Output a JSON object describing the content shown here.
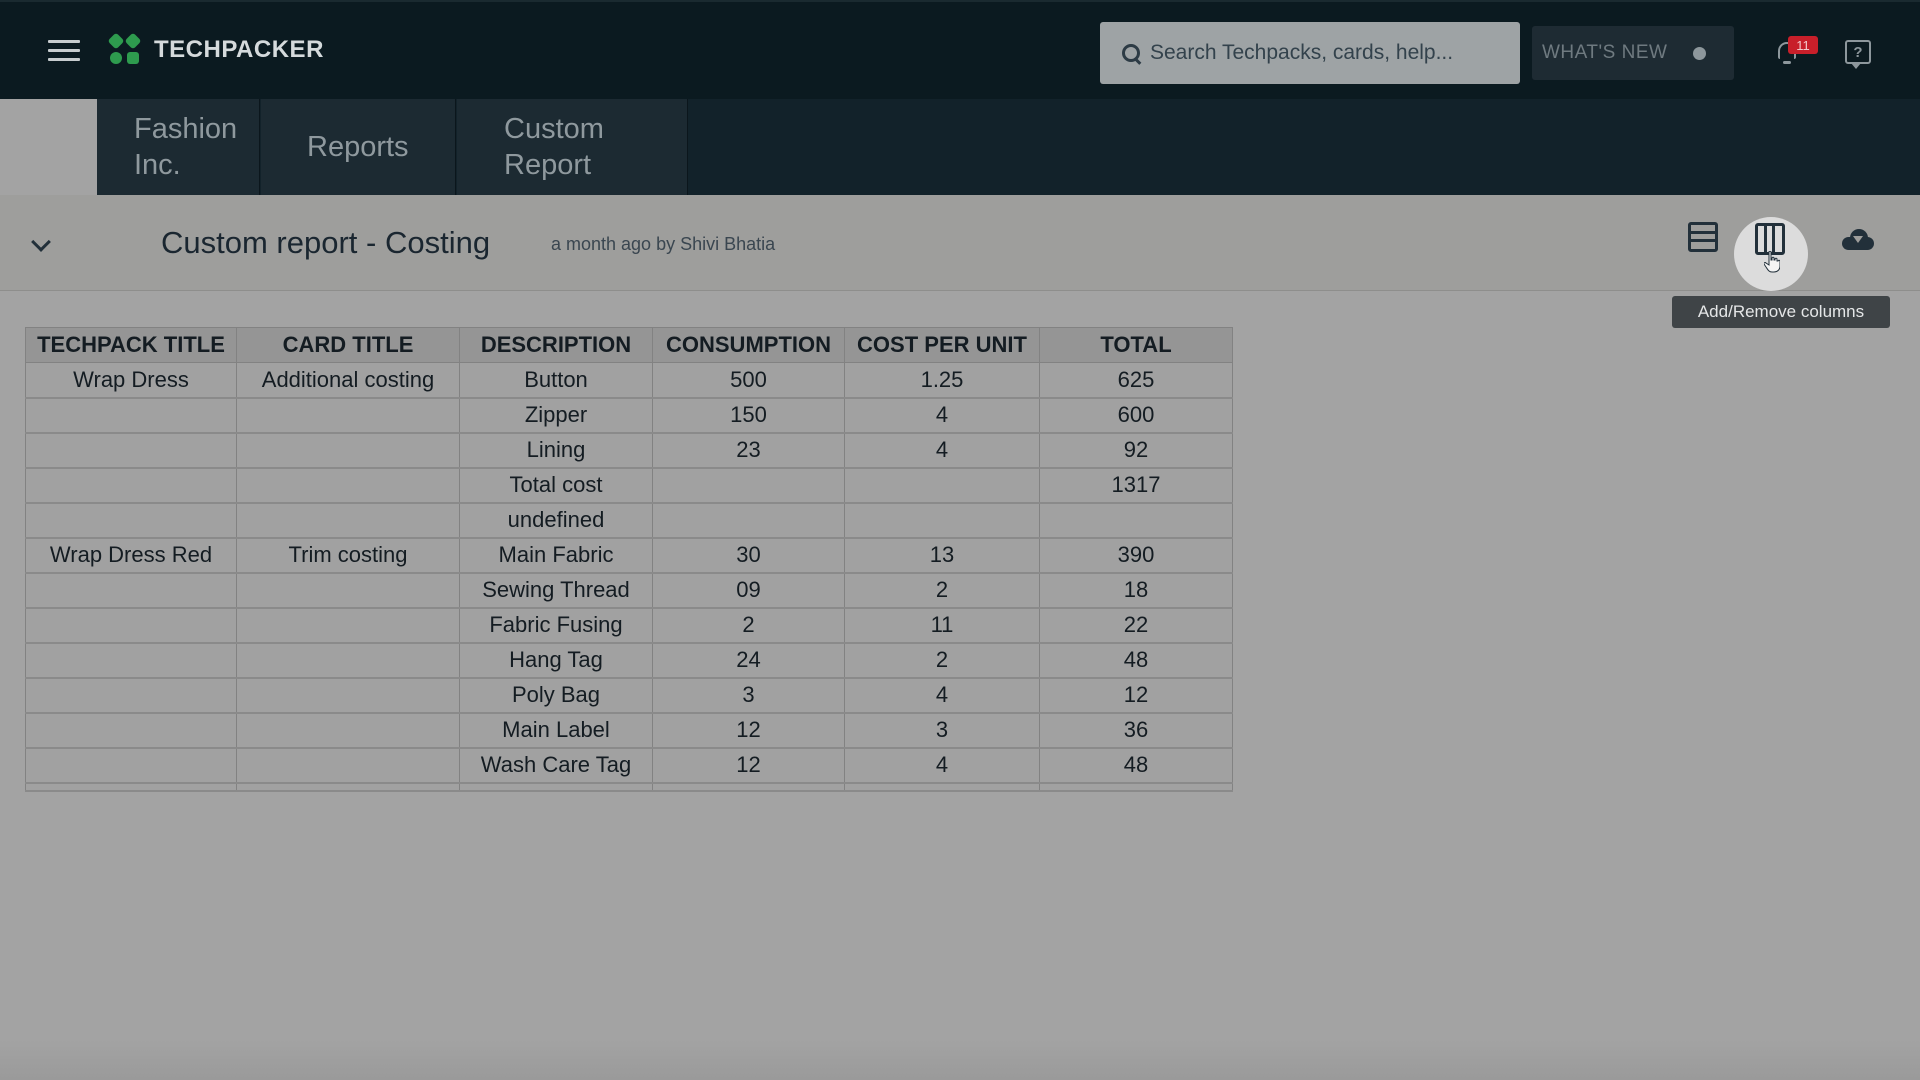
{
  "app": {
    "name": "TECHPACKER"
  },
  "search": {
    "placeholder": "Search Techpacks, cards, help..."
  },
  "header": {
    "whats_new": "WHAT'S NEW",
    "notification_count": "11",
    "help_glyph": "?"
  },
  "tabs": [
    {
      "label": "Fashion Inc."
    },
    {
      "label": "Reports"
    },
    {
      "label": "Custom Report"
    }
  ],
  "report": {
    "title": "Custom report - Costing",
    "meta": "a month ago by Shivi Bhatia",
    "tooltip": "Add/Remove columns"
  },
  "table": {
    "columns": [
      "TECHPACK TITLE",
      "CARD TITLE",
      "DESCRIPTION",
      "CONSUMPTION",
      "COST PER UNIT",
      "TOTAL"
    ],
    "rows": [
      [
        "Wrap Dress",
        "Additional costing",
        "Button",
        "500",
        "1.25",
        "625"
      ],
      [
        "",
        "",
        "Zipper",
        "150",
        "4",
        "600"
      ],
      [
        "",
        "",
        "Lining",
        "23",
        "4",
        "92"
      ],
      [
        "",
        "",
        "Total cost",
        "",
        "",
        "1317"
      ],
      [
        "",
        "",
        "undefined",
        "",
        "",
        ""
      ],
      [
        "Wrap Dress Red",
        "Trim costing",
        "Main Fabric",
        "30",
        "13",
        "390"
      ],
      [
        "",
        "",
        "Sewing Thread",
        "09",
        "2",
        "18"
      ],
      [
        "",
        "",
        "Fabric Fusing",
        "2",
        "11",
        "22"
      ],
      [
        "",
        "",
        "Hang Tag",
        "24",
        "2",
        "48"
      ],
      [
        "",
        "",
        "Poly Bag",
        "3",
        "4",
        "12"
      ],
      [
        "",
        "",
        "Main Label",
        "12",
        "3",
        "36"
      ],
      [
        "",
        "",
        "Wash Care Tag",
        "12",
        "4",
        "48"
      ]
    ]
  },
  "icons": {
    "menu": "hamburger-icon",
    "search": "search-icon",
    "bell": "bell-icon",
    "help": "help-chat-icon",
    "collapse": "chevron-down-icon",
    "rows": "rows-layout-icon",
    "columns": "columns-layout-icon",
    "download": "cloud-download-icon"
  },
  "colors": {
    "brand": "#2e9b4e",
    "topbar": "#0b1a20",
    "badge": "#c81f2a"
  }
}
